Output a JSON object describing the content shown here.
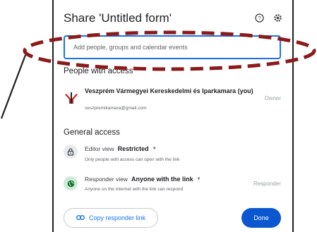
{
  "dialog": {
    "title": "Share 'Untitled form'"
  },
  "search": {
    "placeholder": "Add people, groups and calendar events"
  },
  "people_section": {
    "label": "People with access",
    "owner": {
      "name": "Veszprém Vármegyei Kereskedelmi és Iparkamara (you)",
      "email": "veszpremikamara@gmail.com",
      "role": "Owner"
    }
  },
  "general_access": {
    "label": "General access",
    "editor": {
      "view_label": "Editor view",
      "value": "Restricted",
      "description": "Only people with access can open with the link"
    },
    "responder": {
      "view_label": "Responder view",
      "value": "Anyone with the link",
      "description": "Anyone on the Internet with the link can respond",
      "role": "Responder"
    }
  },
  "footer": {
    "copy_label": "Copy responder link",
    "done_label": "Done"
  },
  "colors": {
    "accent": "#1a73e8",
    "done_button": "#0b57d0",
    "annotation": "#8b1a1a"
  },
  "icons": [
    "help-icon",
    "gear-icon",
    "lock-icon",
    "globe-icon",
    "link-icon",
    "chamber-logo"
  ]
}
